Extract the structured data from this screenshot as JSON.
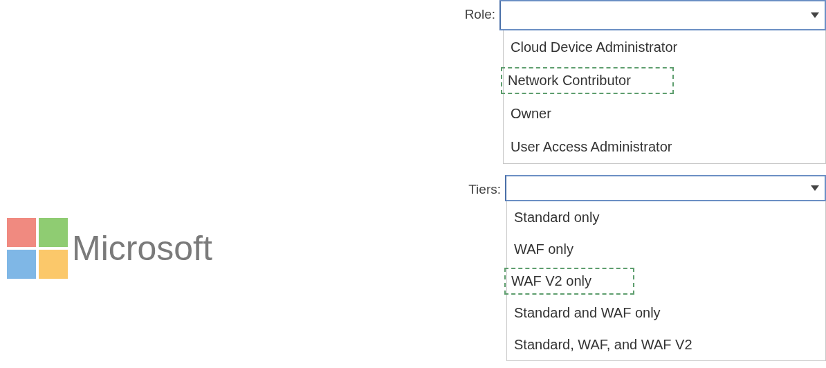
{
  "role": {
    "label": "Role:",
    "options": [
      {
        "label": "Cloud Device Administrator",
        "selected": false
      },
      {
        "label": "Network Contributor",
        "selected": true
      },
      {
        "label": "Owner",
        "selected": false
      },
      {
        "label": "User Access Administrator",
        "selected": false
      }
    ]
  },
  "logo": {
    "text": "Microsoft"
  },
  "tiers": {
    "label": "Tiers:",
    "options": [
      {
        "label": "Standard only",
        "selected": false
      },
      {
        "label": "WAF only",
        "selected": false
      },
      {
        "label": "WAF V2 only",
        "selected": true
      },
      {
        "label": "Standard and WAF only",
        "selected": false
      },
      {
        "label": "Standard, WAF, and WAF V2",
        "selected": false
      }
    ]
  }
}
